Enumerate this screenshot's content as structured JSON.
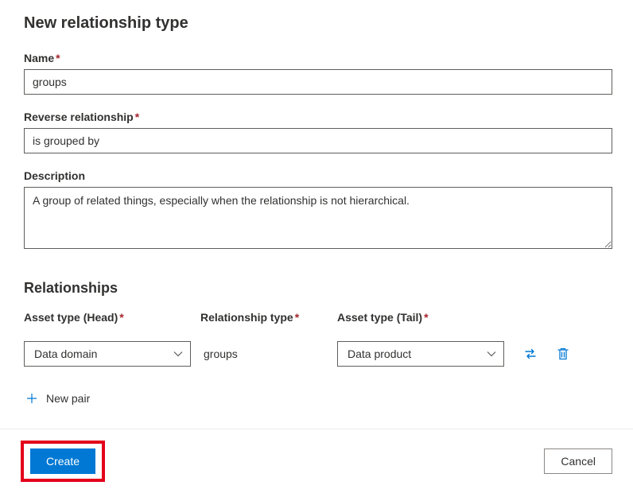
{
  "page_title": "New relationship type",
  "fields": {
    "name": {
      "label": "Name",
      "value": "groups"
    },
    "reverse": {
      "label": "Reverse relationship",
      "value": "is grouped by"
    },
    "description": {
      "label": "Description",
      "value": "A group of related things, especially when the relationship is not hierarchical."
    }
  },
  "relationships_section": {
    "title": "Relationships",
    "headers": {
      "head": "Asset type (Head)",
      "type": "Relationship type",
      "tail": "Asset type (Tail)"
    },
    "row": {
      "head": "Data domain",
      "type": "groups",
      "tail": "Data product"
    },
    "new_pair_label": "New pair"
  },
  "footer": {
    "create": "Create",
    "cancel": "Cancel"
  }
}
